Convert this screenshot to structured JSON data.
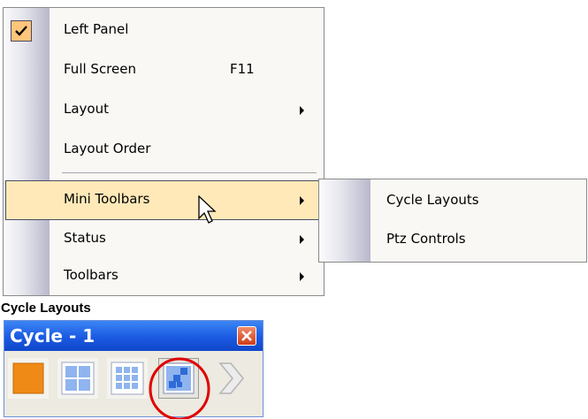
{
  "menu": {
    "items": [
      {
        "label": "Left Panel",
        "checked": true
      },
      {
        "label": "Full Screen",
        "shortcut": "F11"
      },
      {
        "label": "Layout",
        "submenu": true
      },
      {
        "label": "Layout Order"
      },
      {
        "label": "Mini Toolbars",
        "submenu": true,
        "highlighted": true
      },
      {
        "label": "Status",
        "submenu": true
      },
      {
        "label": "Toolbars",
        "submenu": true
      }
    ]
  },
  "submenu": {
    "items": [
      {
        "label": "Cycle Layouts"
      },
      {
        "label": "Ptz Controls"
      }
    ]
  },
  "caption": "Cycle Layouts",
  "toolbar": {
    "title": "Cycle - 1",
    "buttons": [
      "layout-1x1",
      "layout-2x2",
      "layout-3x3",
      "layout-custom",
      "next"
    ],
    "highlighted_button": "layout-custom"
  },
  "colors": {
    "menu_bg": "#f9f8f4",
    "highlight": "#ffe9b8",
    "title_bar": "#1b5ae2",
    "annotation_circle": "#e00000"
  }
}
